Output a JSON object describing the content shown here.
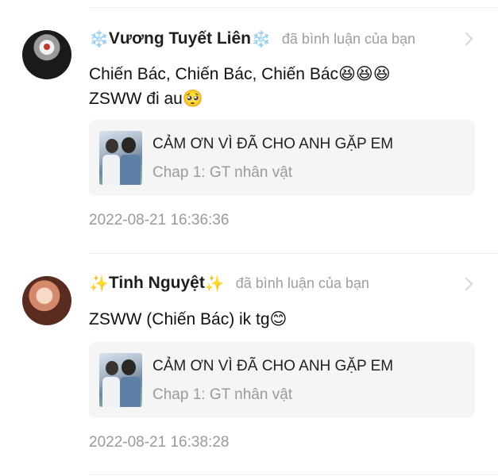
{
  "comments": [
    {
      "user": {
        "prefix_emoji": "❄️",
        "name": "Vương Tuyết Liên",
        "suffix_emoji": "❄️"
      },
      "action": "đã bình luận của bạn",
      "text_line1": "Chiến Bác, Chiến Bác, Chiến Bác😆😆😆",
      "text_line2": "ZSWW đi au🥺",
      "card": {
        "title": "CẢM ƠN VÌ ĐÃ CHO ANH GẶP EM",
        "subtitle": "Chap 1: GT nhân vật"
      },
      "timestamp": "2022-08-21 16:36:36"
    },
    {
      "user": {
        "prefix_emoji": "✨",
        "name": "Tinh Nguyệt",
        "suffix_emoji": "✨"
      },
      "action": "đã bình luận của bạn",
      "text_line1": "ZSWW (Chiến Bác) ik tg😊",
      "card": {
        "title": "CẢM ƠN VÌ ĐÃ CHO ANH GẶP EM",
        "subtitle": "Chap 1: GT nhân vật"
      },
      "timestamp": "2022-08-21 16:38:28"
    }
  ]
}
